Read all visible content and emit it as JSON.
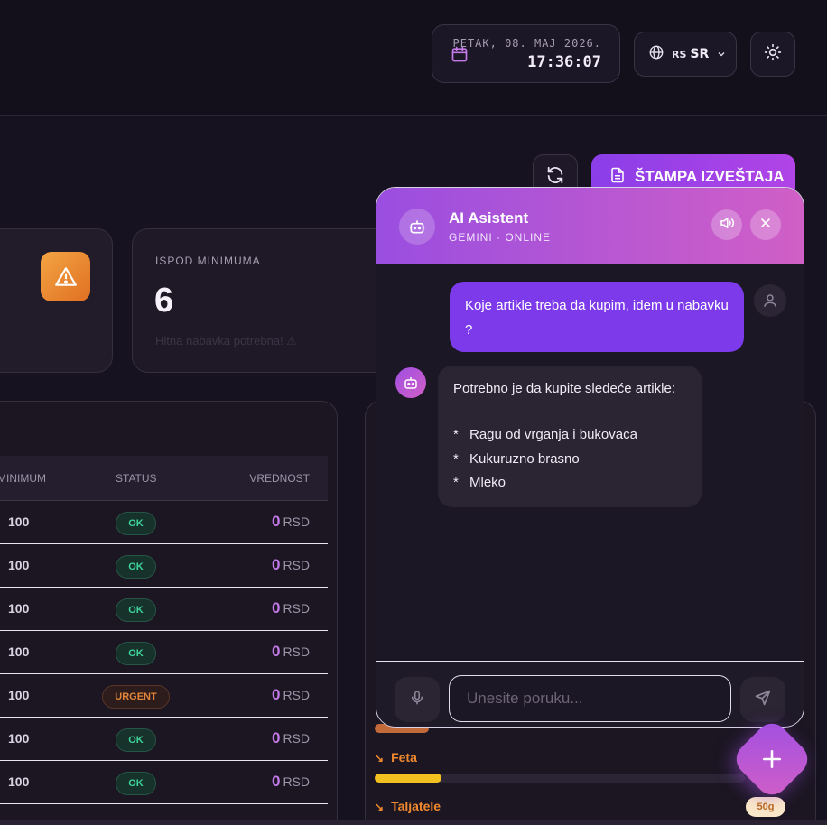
{
  "topbar": {
    "date": "PETAK, 08. MAJ 2026.",
    "time": "17:36:07",
    "lang_flag": "RS",
    "lang_code": "SR",
    "icons": [
      "calendar-icon",
      "globe-icon",
      "chevron-down-icon",
      "sun-icon"
    ]
  },
  "toolbar": {
    "print_label": "ŠTAMPA IZVEŠTAJA"
  },
  "stats": {
    "below_min_label": "ISPOD MINIMUMA",
    "below_min_value": "6",
    "below_min_sub": "Hitna nabavka potrebna! ⚠"
  },
  "table": {
    "headers": [
      "MINIMUM",
      "STATUS",
      "VREDNOST"
    ],
    "currency": "RSD",
    "rows": [
      {
        "min": "100",
        "status": "OK",
        "value": "0"
      },
      {
        "min": "100",
        "status": "OK",
        "value": "0"
      },
      {
        "min": "100",
        "status": "OK",
        "value": "0"
      },
      {
        "min": "100",
        "status": "OK",
        "value": "0"
      },
      {
        "min": "100",
        "status": "URGENT",
        "value": "0"
      },
      {
        "min": "100",
        "status": "OK",
        "value": "0"
      },
      {
        "min": "100",
        "status": "OK",
        "value": "0"
      }
    ]
  },
  "products": {
    "items": [
      {
        "name": "Feta",
        "fill": 0.18
      },
      {
        "name": "Taljatele",
        "badge": "50g"
      }
    ]
  },
  "chat": {
    "title": "AI Asistent",
    "subtitle": "GEMINI · ONLINE",
    "user_message": "Koje artikle treba da kupim, idem u nabavku ?",
    "bot_intro": "Potrebno je da kupite sledeće artikle:",
    "bot_items": [
      "Ragu od vrganja i bukovaca",
      "Kukuruzno brasno",
      "Mleko"
    ],
    "input_placeholder": "Unesite poruku...",
    "input_value": ""
  },
  "colors": {
    "accent": "#8b3ee8",
    "accent2": "#d15fc6",
    "ok": "#3ed39a",
    "urgent": "#e2843a",
    "warning": "#f0892e"
  }
}
